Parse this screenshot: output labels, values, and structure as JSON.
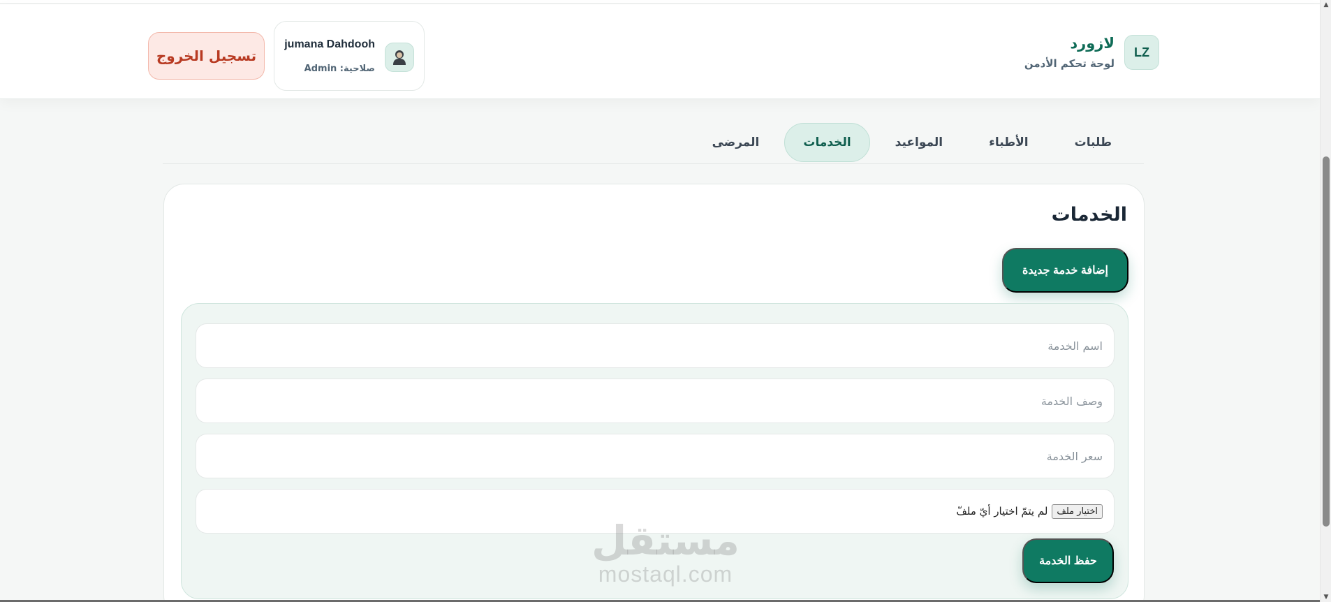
{
  "brand": {
    "badge": "LZ",
    "name": "لازورد",
    "subtitle": "لوحة تحكم الأدمن"
  },
  "user": {
    "name": "jumana Dahdooh",
    "role": "صلاحية: Admin"
  },
  "header": {
    "logout_label": "تسجيل الخروج"
  },
  "tabs": [
    {
      "label": "المرضى",
      "active": false
    },
    {
      "label": "الخدمات",
      "active": true
    },
    {
      "label": "المواعيد",
      "active": false
    },
    {
      "label": "الأطباء",
      "active": false
    },
    {
      "label": "طلبات",
      "active": false
    }
  ],
  "card": {
    "title": "الخدمات",
    "add_label": "إضافة خدمة جديدة"
  },
  "form": {
    "name_placeholder": "اسم الخدمة",
    "description_placeholder": "وصف الخدمة",
    "price_placeholder": "سعر الخدمة",
    "file_button": "اختيار ملف",
    "file_status": "لم يتمّ اختيار أيّ ملفّ",
    "save_label": "حفظ الخدمة"
  },
  "watermark": {
    "arabic": "مستقل",
    "latin": "mostaql.com"
  },
  "colors": {
    "primary": "#0f7a62",
    "primary_soft": "#dcefe9",
    "danger": "#b83a22",
    "danger_soft": "#fde9e5"
  }
}
